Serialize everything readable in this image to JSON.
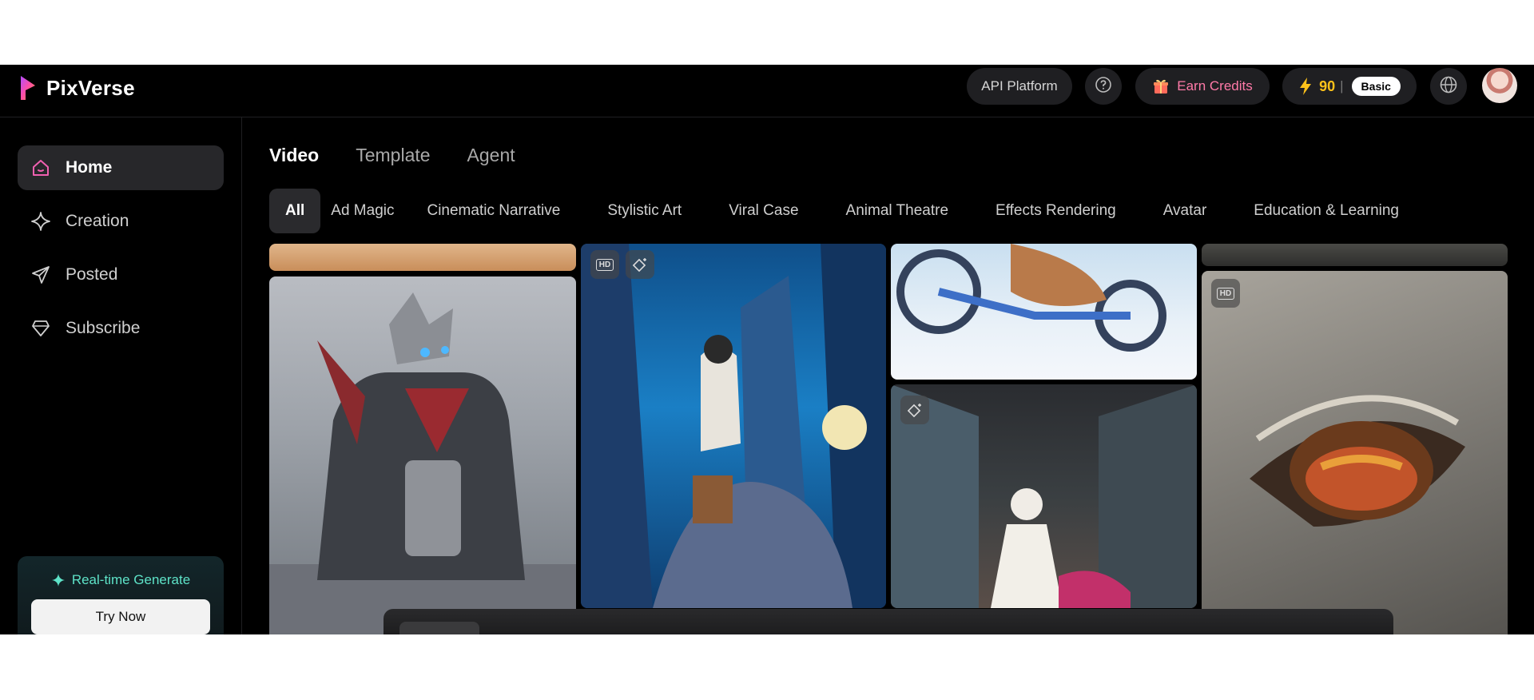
{
  "brand": {
    "name": "PixVerse"
  },
  "header": {
    "api_platform": "API Platform",
    "earn_credits": "Earn Credits",
    "credits": "90",
    "plan": "Basic"
  },
  "sidebar": {
    "items": [
      {
        "label": "Home",
        "icon": "home-icon",
        "active": true
      },
      {
        "label": "Creation",
        "icon": "sparkle-icon"
      },
      {
        "label": "Posted",
        "icon": "send-icon"
      },
      {
        "label": "Subscribe",
        "icon": "tag-icon"
      }
    ],
    "promo": {
      "title": "Real-time Generate",
      "button": "Try Now"
    }
  },
  "main": {
    "tabs": [
      "Video",
      "Template",
      "Agent"
    ],
    "categories": [
      "All",
      "Ad Magic",
      "Cinematic Narrative",
      "Stylistic Art",
      "Viral Case",
      "Animal Theatre",
      "Effects Rendering",
      "Avatar",
      "Education & Learning"
    ]
  },
  "colors": {
    "accent": "#f060b0",
    "credits": "#ffc21a",
    "earn": "#ff7aa8",
    "promo": "#5ee3c8"
  }
}
